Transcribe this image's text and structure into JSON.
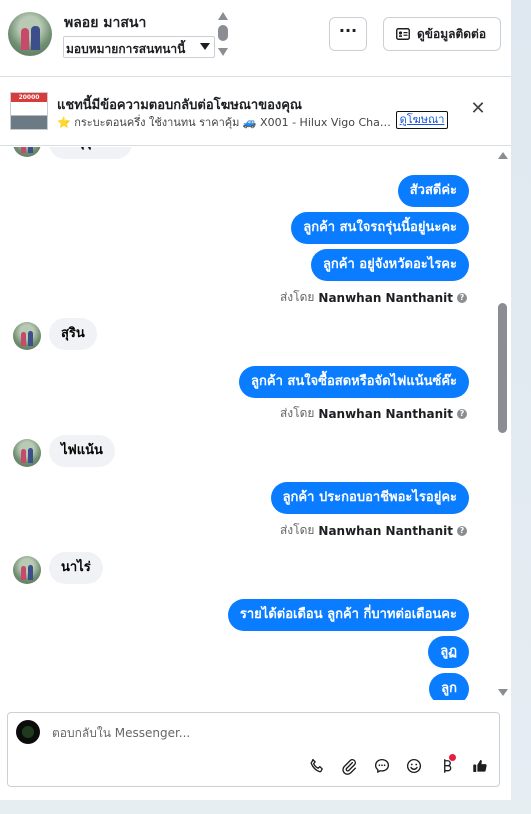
{
  "header": {
    "contact_name": "พลอย มาสนา",
    "assign_value": "มอบหมายการสนทนานี้",
    "more_label": "···",
    "contact_info_label": "ดูข้อมูลติดต่อ"
  },
  "ad": {
    "thumb_tag": "20000",
    "title": "แชทนี้มีข้อความตอบกลับต่อโฆษณาของคุณ",
    "description": "⭐ กระบะตอนครึ่ง ใช้งานทน ราคาคุ้ม 🚙 X001 - Hilux Vigo Champ Cab...",
    "link_label": "ดูโฆษณา",
    "close_label": "✕"
  },
  "messages": [
    {
      "from": "contact",
      "text": "ทะลุรุ่นเก่า",
      "partial": true
    },
    {
      "from": "page",
      "text": "สัวสดีค่ะ"
    },
    {
      "from": "page",
      "text": "ลูกค้า  สนใจรถรุ่นนี้อยู่นะคะ"
    },
    {
      "from": "page",
      "text": "ลูกค้า อยู่จังหวัดอะไรคะ"
    },
    {
      "from": "meta",
      "sent_prefix": "ส่งโดย",
      "sender": "Nanwhan Nanthanit"
    },
    {
      "from": "contact",
      "text": "สุริน"
    },
    {
      "from": "page",
      "text": "ลูกค้า สนใจซื้อสดหรือจัดไฟแน้นซ์ค๊ะ"
    },
    {
      "from": "meta",
      "sent_prefix": "ส่งโดย",
      "sender": "Nanwhan Nanthanit"
    },
    {
      "from": "contact",
      "text": "ไฟแน้น"
    },
    {
      "from": "page",
      "text": "ลูกค้า ประกอบอาชีพอะไรอยู่คะ"
    },
    {
      "from": "meta",
      "sent_prefix": "ส่งโดย",
      "sender": "Nanwhan Nanthanit"
    },
    {
      "from": "contact",
      "text": "นาไร่"
    },
    {
      "from": "page",
      "text": "รายได้ต่อเดือน  ลูกค้า กี่บาทต่อเดือนคะ"
    },
    {
      "from": "page",
      "text": "ลูฏ"
    },
    {
      "from": "page",
      "text": "ลูก"
    }
  ],
  "composer": {
    "placeholder": "ตอบกลับใน Messenger..."
  },
  "icons": {
    "phone": "phone-icon",
    "attach": "paperclip-icon",
    "saved_reply": "chat-bubble-icon",
    "emoji": "smiley-icon",
    "payment": "baht-icon",
    "like": "thumbs-up-icon"
  }
}
